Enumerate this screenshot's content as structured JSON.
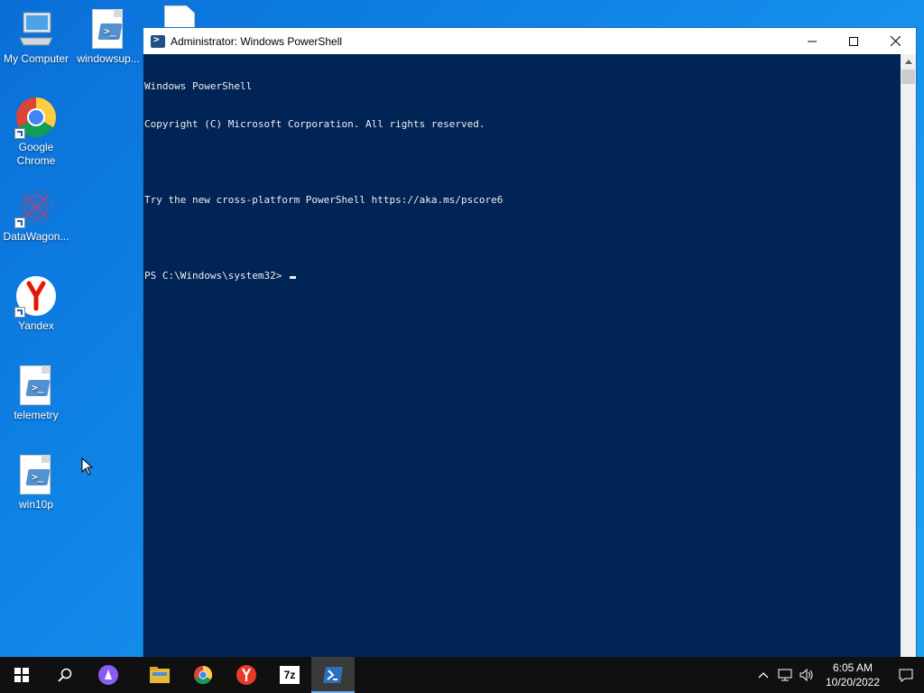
{
  "desktop": {
    "icons": [
      {
        "label": "My Computer"
      },
      {
        "label": "windowsup..."
      },
      {
        "label": "Google Chrome"
      },
      {
        "label": "DataWagon..."
      },
      {
        "label": "Yandex"
      },
      {
        "label": "telemetry"
      },
      {
        "label": "win10p"
      }
    ]
  },
  "window": {
    "title": "Administrator: Windows PowerShell",
    "console_lines": [
      "Windows PowerShell",
      "Copyright (C) Microsoft Corporation. All rights reserved.",
      "",
      "Try the new cross-platform PowerShell https://aka.ms/pscore6",
      "",
      "PS C:\\Windows\\system32> "
    ]
  },
  "taskbar": {
    "pinned": [
      "start-icon",
      "search-icon",
      "alice-icon",
      "file-explorer-icon",
      "chrome-icon",
      "yandex-browser-icon",
      "7zip-icon",
      "powershell-icon"
    ],
    "sevenzip_label": "7z",
    "time": "6:05 AM",
    "date": "10/20/2022"
  },
  "colors": {
    "console_bg": "#012456",
    "console_fg": "#eeedf0",
    "desktop": "#1a8fe8",
    "taskbar": "#101010"
  }
}
